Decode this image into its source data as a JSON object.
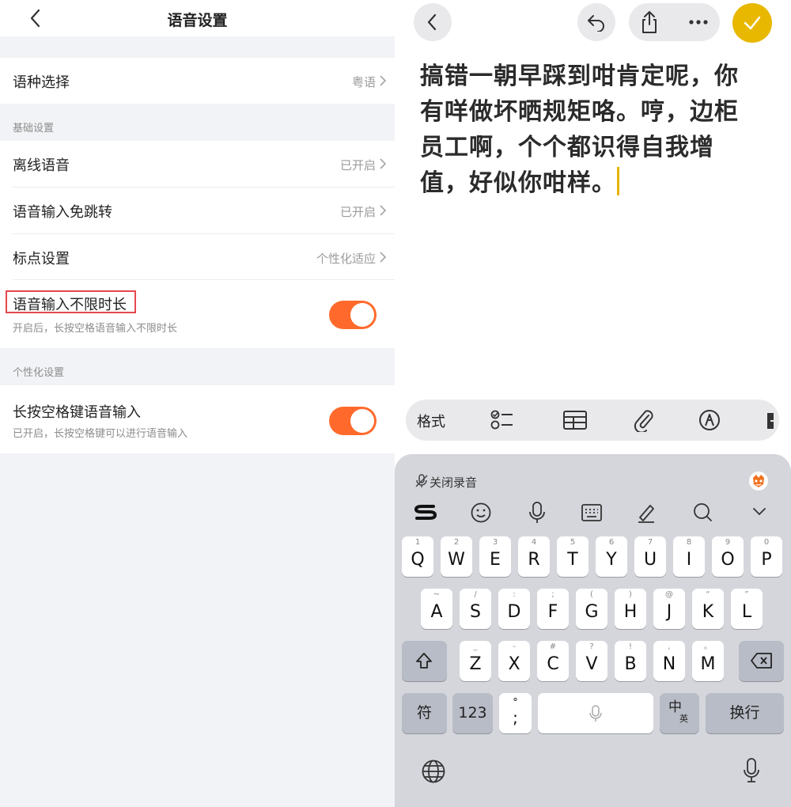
{
  "settings": {
    "title": "语音设置",
    "language": {
      "label": "语种选择",
      "value": "粤语"
    },
    "basic_section": "基础设置",
    "offline": {
      "label": "离线语音",
      "value": "已开启"
    },
    "no_jump": {
      "label": "语音输入免跳转",
      "value": "已开启"
    },
    "punct": {
      "label": "标点设置",
      "value": "个性化适应"
    },
    "unlimited": {
      "label": "语音输入不限时长",
      "sub": "开启后，长按空格语音输入不限时长",
      "on": true
    },
    "personal_section": "个性化设置",
    "longpress": {
      "label": "长按空格键语音输入",
      "sub": "已开启，长按空格键可以进行语音输入",
      "on": true
    }
  },
  "note": {
    "text": "搞错一朝早踩到咁肯定呢，你有咩做坏晒规矩咯。哼，边柜员工啊，个个都识得自我增值，好似你咁样。"
  },
  "toolbar": {
    "format": "格式"
  },
  "keyboard": {
    "voice_status": "关闭录音",
    "row1": [
      {
        "k": "Q",
        "s": "1"
      },
      {
        "k": "W",
        "s": "2"
      },
      {
        "k": "E",
        "s": "3"
      },
      {
        "k": "R",
        "s": "4"
      },
      {
        "k": "T",
        "s": "5"
      },
      {
        "k": "Y",
        "s": "6"
      },
      {
        "k": "U",
        "s": "7"
      },
      {
        "k": "I",
        "s": "8"
      },
      {
        "k": "O",
        "s": "9"
      },
      {
        "k": "P",
        "s": "0"
      }
    ],
    "row2": [
      {
        "k": "A",
        "s": "~"
      },
      {
        "k": "S",
        "s": "/"
      },
      {
        "k": "D",
        "s": ":"
      },
      {
        "k": "F",
        "s": ";"
      },
      {
        "k": "G",
        "s": "("
      },
      {
        "k": "H",
        "s": ")"
      },
      {
        "k": "J",
        "s": "@"
      },
      {
        "k": "K",
        "s": "“"
      },
      {
        "k": "L",
        "s": "”"
      }
    ],
    "row3": [
      {
        "k": "Z",
        "s": "_"
      },
      {
        "k": "X",
        "s": "-"
      },
      {
        "k": "C",
        "s": "#"
      },
      {
        "k": "V",
        "s": "?"
      },
      {
        "k": "B",
        "s": "!"
      },
      {
        "k": "N",
        "s": ","
      },
      {
        "k": "M",
        "s": "。"
      }
    ],
    "symbol_key": "符",
    "num_key": "123",
    "punct_top": "°",
    "punct_bottom": ";",
    "lang_main": "中",
    "lang_sub": "英",
    "enter_key": "换行"
  },
  "colors": {
    "toggle_on": "#ff6a2c",
    "confirm": "#e8b800",
    "highlight_box": "#e5474f"
  }
}
